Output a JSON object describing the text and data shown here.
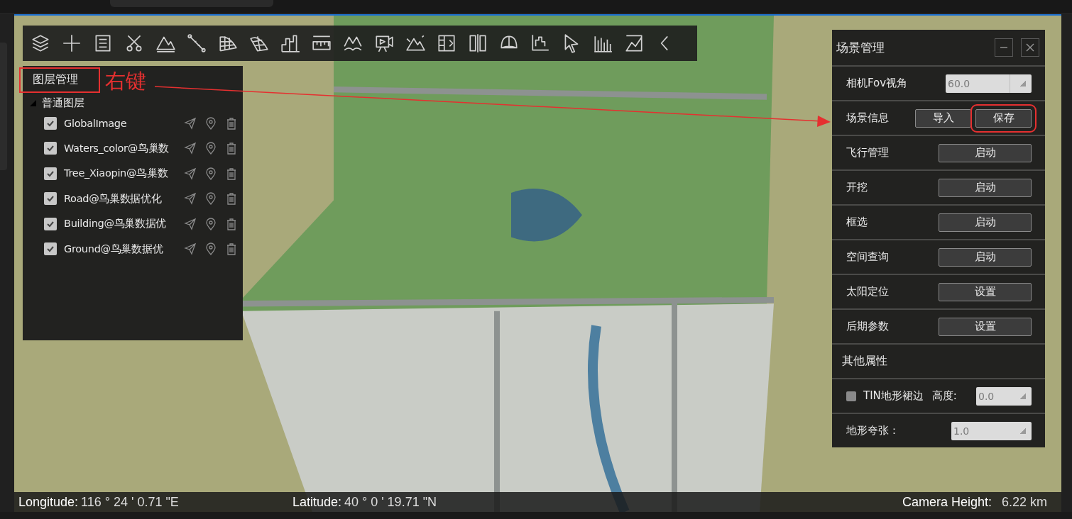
{
  "layer_panel": {
    "title": "图层管理",
    "group": {
      "label": "普通图层",
      "expanded": true,
      "layers": [
        {
          "name": "GlobalImage",
          "checked": true
        },
        {
          "name": "Waters_color@鸟巢数",
          "checked": true
        },
        {
          "name": "Tree_Xiaopin@鸟巢数",
          "checked": true
        },
        {
          "name": "Road@鸟巢数据优化",
          "checked": true
        },
        {
          "name": "Building@鸟巢数据优",
          "checked": true
        },
        {
          "name": "Ground@鸟巢数据优",
          "checked": true
        }
      ]
    }
  },
  "annotation": {
    "label": "右键"
  },
  "scene_panel": {
    "title": "场景管理",
    "rows": [
      {
        "kind": "spin",
        "label": "相机Fov视角",
        "value": "60.0"
      },
      {
        "kind": "buttons",
        "label": "场景信息",
        "buttons": [
          {
            "label": "导入",
            "highlighted": false
          },
          {
            "label": "保存",
            "highlighted": true
          }
        ]
      },
      {
        "kind": "button",
        "label": "飞行管理",
        "button": "启动"
      },
      {
        "kind": "button",
        "label": "开挖",
        "button": "启动"
      },
      {
        "kind": "button",
        "label": "框选",
        "button": "启动"
      },
      {
        "kind": "button",
        "label": "空间查询",
        "button": "启动"
      },
      {
        "kind": "button",
        "label": "太阳定位",
        "button": "设置"
      },
      {
        "kind": "button",
        "label": "后期参数",
        "button": "设置"
      },
      {
        "kind": "heading",
        "label": "其他属性"
      },
      {
        "kind": "check_spin",
        "label": "TIN地形裙边",
        "checked": false,
        "field_label": "高度:",
        "value": "0.0"
      },
      {
        "kind": "spin",
        "label": "地形夸张：",
        "value": "1.0"
      }
    ]
  },
  "status_bar": {
    "longitude_label": "Longitude:",
    "longitude": "116 ° 24 ' 0.71 \"E",
    "latitude_label": "Latitude:",
    "latitude": "40 ° 0 ' 19.71 \"N",
    "height_label": "Camera Height:",
    "height": "6.22 km"
  }
}
